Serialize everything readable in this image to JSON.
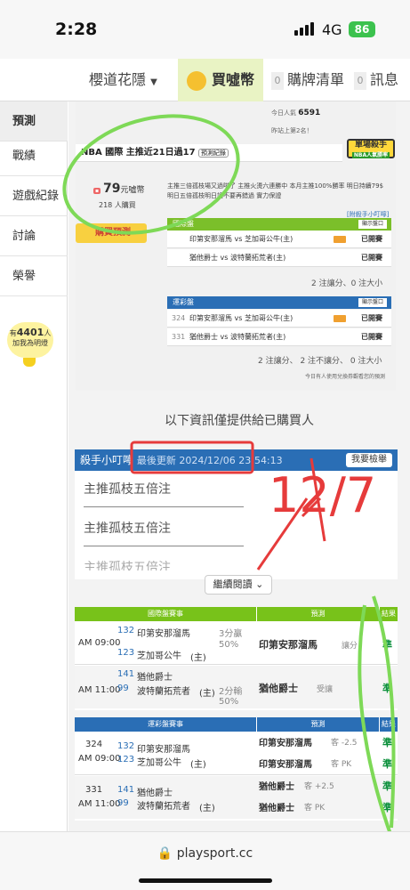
{
  "status": {
    "time": "2:28",
    "network": "4G",
    "battery": "86"
  },
  "nav": {
    "city": "櫻道花隱",
    "buy": "買噓幣",
    "cart_count": "0",
    "cart": "購牌清單",
    "msg_count": "0",
    "msg": "訊息"
  },
  "sidebar": {
    "items": [
      "預測",
      "戰績",
      "遊戲紀錄",
      "討論",
      "榮譽"
    ],
    "visitors_prefix": "有",
    "visitors": "4401",
    "visitors_suffix": "人",
    "visitors_note": "加我為明燈"
  },
  "panel": {
    "today_label": "今日人氣",
    "today_count": "6591",
    "rank_note": "昨站上第2名！",
    "badge_title": "單場殺手",
    "badge_sub": "NBA人氣勝率",
    "header": "NBA 國際 主推近21日過17",
    "prediction_tag": "預測紀錄",
    "price": "79",
    "price_unit": "元噓幣",
    "buyers": "218 人購買",
    "buy_button": "購買預測",
    "desc": "主推三倍孤枝場又過啦了 主推火燙六連勝中 本月主推100%勝率 明日持續79$ 明日五倍孤枝明日請不要再錯過 實力保證",
    "tips_link": "[附殺手小叮嚀]",
    "intl_label": "國際盤",
    "show_btn": "顯示盤口",
    "intl_rows": [
      {
        "match": "印第安那溜馬 vs 芝加哥公牛(主)",
        "status": "已開賽"
      },
      {
        "match": "猶他爵士 vs 波特蘭拓荒者(主)",
        "status": "已開賽"
      }
    ],
    "intl_summary": "2 注讓分、0 注大小",
    "tw_label": "運彩盤",
    "tw_rows": [
      {
        "id": "324",
        "match": "印第安那溜馬 vs 芝加哥公牛(主)",
        "status": "已開賽"
      },
      {
        "id": "331",
        "match": "猶他爵士 vs 波特蘭拓荒者(主)",
        "status": "已開賽"
      }
    ],
    "tw_summary": "2 注讓分、 2 注不讓分、 0 注大小",
    "tw_note": "今日有人使用兌換券觀看您的預測"
  },
  "info_line": "以下資訊僅提供給已購買人",
  "card": {
    "title": "殺手小叮嚀",
    "updated": "最後更新 2024/12/06 23:54:13",
    "report": "我要檢舉",
    "lines": [
      "主推孤枝五倍注",
      "主推孤枝五倍注",
      "主推孤枝五倍注"
    ],
    "more": "繼續閱讀"
  },
  "intl_table": {
    "head": [
      "國際盤賽事",
      "預測",
      "結果"
    ],
    "rows": [
      {
        "time": "AM 09:00",
        "num_a": "132",
        "team_a": "印第安那溜馬",
        "num_b": "123",
        "team_b": "芝加哥公牛",
        "mark_b": "(主)",
        "line1": "3分贏",
        "line2": "50%",
        "pick": "印第安那溜馬",
        "pick_note": "讓分",
        "result": "準"
      },
      {
        "time": "AM 11:00",
        "num_a": "141",
        "team_a": "猶他爵士",
        "num_b": "99",
        "team_b": "波特蘭拓荒者",
        "mark_b": "(主)",
        "line1": "2分輸",
        "line2": "50%",
        "pick": "猶他爵士",
        "pick_note": "受讓",
        "result": "準"
      }
    ]
  },
  "tw_table": {
    "head": [
      "運彩盤賽事",
      "預測",
      "結果"
    ],
    "rows": [
      {
        "id": "324",
        "time": "AM 09:00",
        "num_a": "132",
        "team_a": "印第安那溜馬",
        "num_b": "123",
        "team_b": "芝加哥公牛",
        "mark_b": "(主)",
        "pick1": "印第安那溜馬",
        "note1": "客 -2.5",
        "res1": "準",
        "pick2": "印第安那溜馬",
        "note2": "客 PK",
        "res2": "準"
      },
      {
        "id": "331",
        "time": "AM 11:00",
        "num_a": "141",
        "team_a": "猶他爵士",
        "num_b": "99",
        "team_b": "波特蘭拓荒者",
        "mark_b": "(主)",
        "pick1": "猶他爵士",
        "note1": "客 +2.5",
        "res1": "準",
        "pick2": "猶他爵士",
        "note2": "客 PK",
        "res2": "準"
      }
    ]
  },
  "handwriting": "12/7",
  "url": "playsport.cc"
}
